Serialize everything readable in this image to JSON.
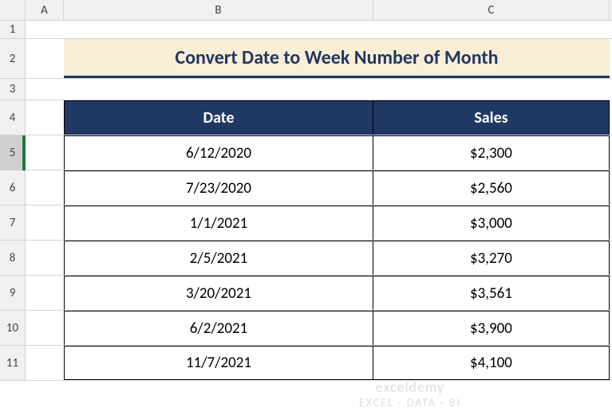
{
  "columns": [
    "A",
    "B",
    "C"
  ],
  "row_numbers": [
    1,
    2,
    3,
    4,
    5,
    6,
    7,
    8,
    9,
    10,
    11
  ],
  "selected_row": 5,
  "title": "Convert Date to Week Number of Month",
  "headers": {
    "date": "Date",
    "sales": "Sales"
  },
  "data_rows": [
    {
      "date": "6/12/2020",
      "sales": "$2,300"
    },
    {
      "date": "7/23/2020",
      "sales": "$2,560"
    },
    {
      "date": "1/1/2021",
      "sales": "$3,000"
    },
    {
      "date": "2/5/2021",
      "sales": "$3,270"
    },
    {
      "date": "3/20/2021",
      "sales": "$3,561"
    },
    {
      "date": "6/2/2021",
      "sales": "$3,900"
    },
    {
      "date": "11/7/2021",
      "sales": "$4,100"
    }
  ],
  "watermark": {
    "line1": "exceldemy",
    "line2": "EXCEL · DATA · BI"
  }
}
